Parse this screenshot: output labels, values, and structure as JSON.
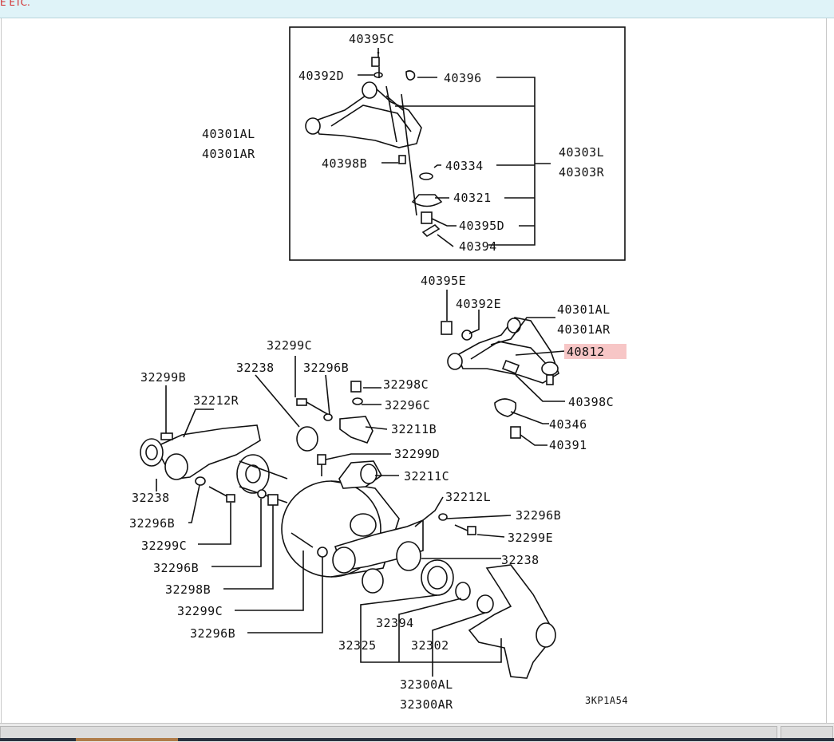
{
  "top_label": "E ETC.",
  "diagram_code": "3KP1A54",
  "highlighted_part": "40812",
  "inset_labels": [
    "40395C",
    "40392D",
    "40396",
    "40301AL",
    "40301AR",
    "40303L",
    "40303R",
    "40398B",
    "40334",
    "40321",
    "40395D",
    "40394"
  ],
  "main_labels": [
    "40395E",
    "40392E",
    "40301AL",
    "40301AR",
    "40812",
    "40398C",
    "40346",
    "40391",
    "32299C",
    "32238",
    "32296B",
    "32298C",
    "32296C",
    "32211B",
    "32299B",
    "32212R",
    "32299D",
    "32211C",
    "32238",
    "32296B",
    "32299C",
    "32296B",
    "32298B",
    "32212L",
    "32296B",
    "32299E",
    "32238",
    "32299C",
    "32296B",
    "32394",
    "32325",
    "32302",
    "32300AL",
    "32300AR"
  ]
}
